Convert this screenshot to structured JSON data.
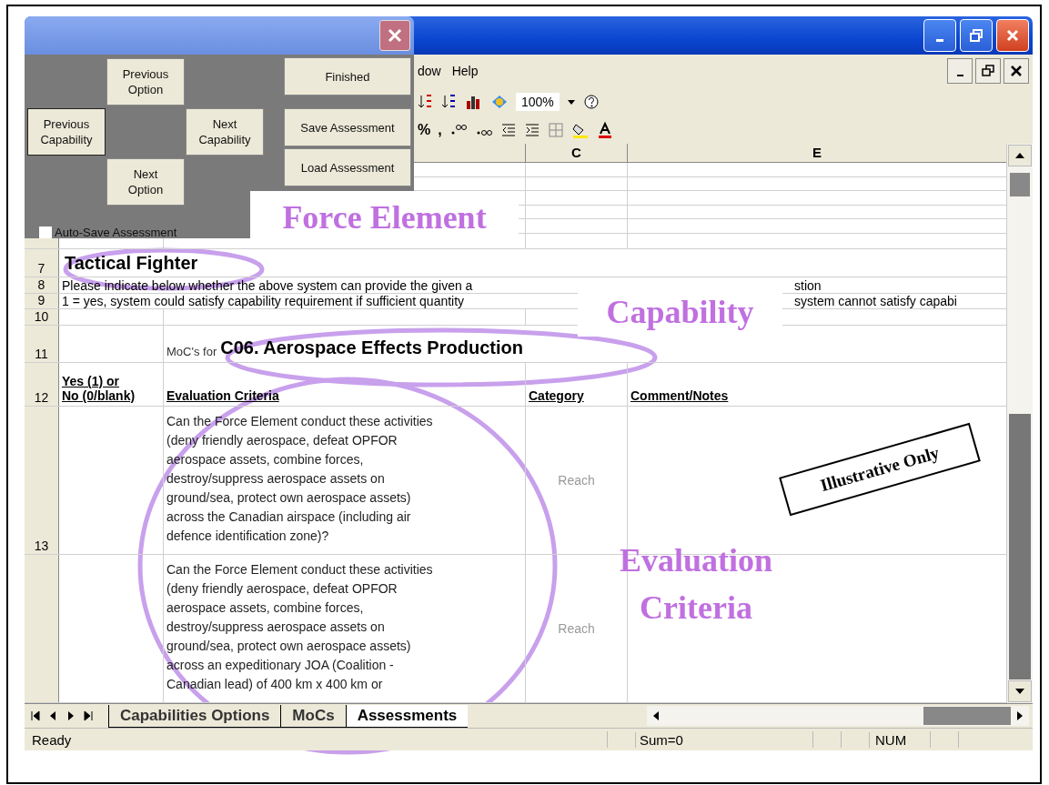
{
  "dialog": {
    "buttons": [
      {
        "label": "Previous\nOption"
      },
      {
        "label": "Previous\nCapability"
      },
      {
        "label": "Next\nCapability"
      },
      {
        "label": "Next\nOption"
      },
      {
        "label": "Finished"
      },
      {
        "label": "Save Assessment"
      },
      {
        "label": "Load Assessment"
      }
    ],
    "auto_save": {
      "label": "Auto-Save Assessment",
      "checked": false
    }
  },
  "menu_bar": {
    "items": [
      "dow",
      "Help"
    ]
  },
  "toolbar": {
    "zoom": "100%",
    "format_items": [
      "%",
      ","
    ]
  },
  "column_headers": {
    "column_3": "C",
    "column_4": "E"
  },
  "rows": [
    {
      "kind": "blank"
    },
    {
      "kind": "title",
      "number": "7",
      "text": "Tactical Fighter"
    },
    {
      "kind": "note",
      "number": "8",
      "text": "Please indicate below whether the above system can provide the given a",
      "text_after": "stion"
    },
    {
      "kind": "note",
      "number": "9",
      "text": "1 = yes, system could satisfy capability requirement if sufficient quantity",
      "text_after": "system cannot satisfy capabi"
    },
    {
      "kind": "blank",
      "number": "10"
    },
    {
      "kind": "heading",
      "number": "11",
      "label": "MoC's for",
      "value": "C06. Aerospace Effects Production"
    },
    {
      "kind": "columns",
      "number": "12",
      "cells": [
        "Yes (1) or\nNo (0/blank)",
        "Evaluation Criteria",
        "Category",
        "Comment/Notes"
      ]
    },
    {
      "kind": "criterion",
      "number": "13",
      "text": "Can the Force Element conduct these activities\n(deny friendly aerospace, defeat OPFOR\naerospace assets, combine forces,\ndestroy/suppress aerospace assets on\nground/sea, protect own aerospace assets)\nacross the Canadian airspace (including air\ndefence identification zone)?",
      "category": "Reach"
    },
    {
      "kind": "criterion",
      "text": "Can the Force Element conduct these activities\n(deny friendly aerospace, defeat OPFOR\naerospace assets, combine forces,\ndestroy/suppress aerospace assets on\nground/sea, protect own aerospace assets)\nacross an expeditionary JOA (Coalition -\nCanadian lead) of 400 km x 400 km or",
      "category": "Reach"
    }
  ],
  "sheet_tabs": [
    {
      "label": "Capabilities Options",
      "selected": false
    },
    {
      "label": "MoCs",
      "selected": false
    },
    {
      "label": "Assessments",
      "selected": true
    }
  ],
  "status_bar": {
    "status": "Ready",
    "sum": "Sum=0",
    "num": "NUM"
  },
  "annotations": {
    "force_element": "Force Element",
    "capability": "Capability",
    "evaluation_criteria": "Evaluation\nCriteria",
    "illustrative": "Illustrative Only"
  }
}
